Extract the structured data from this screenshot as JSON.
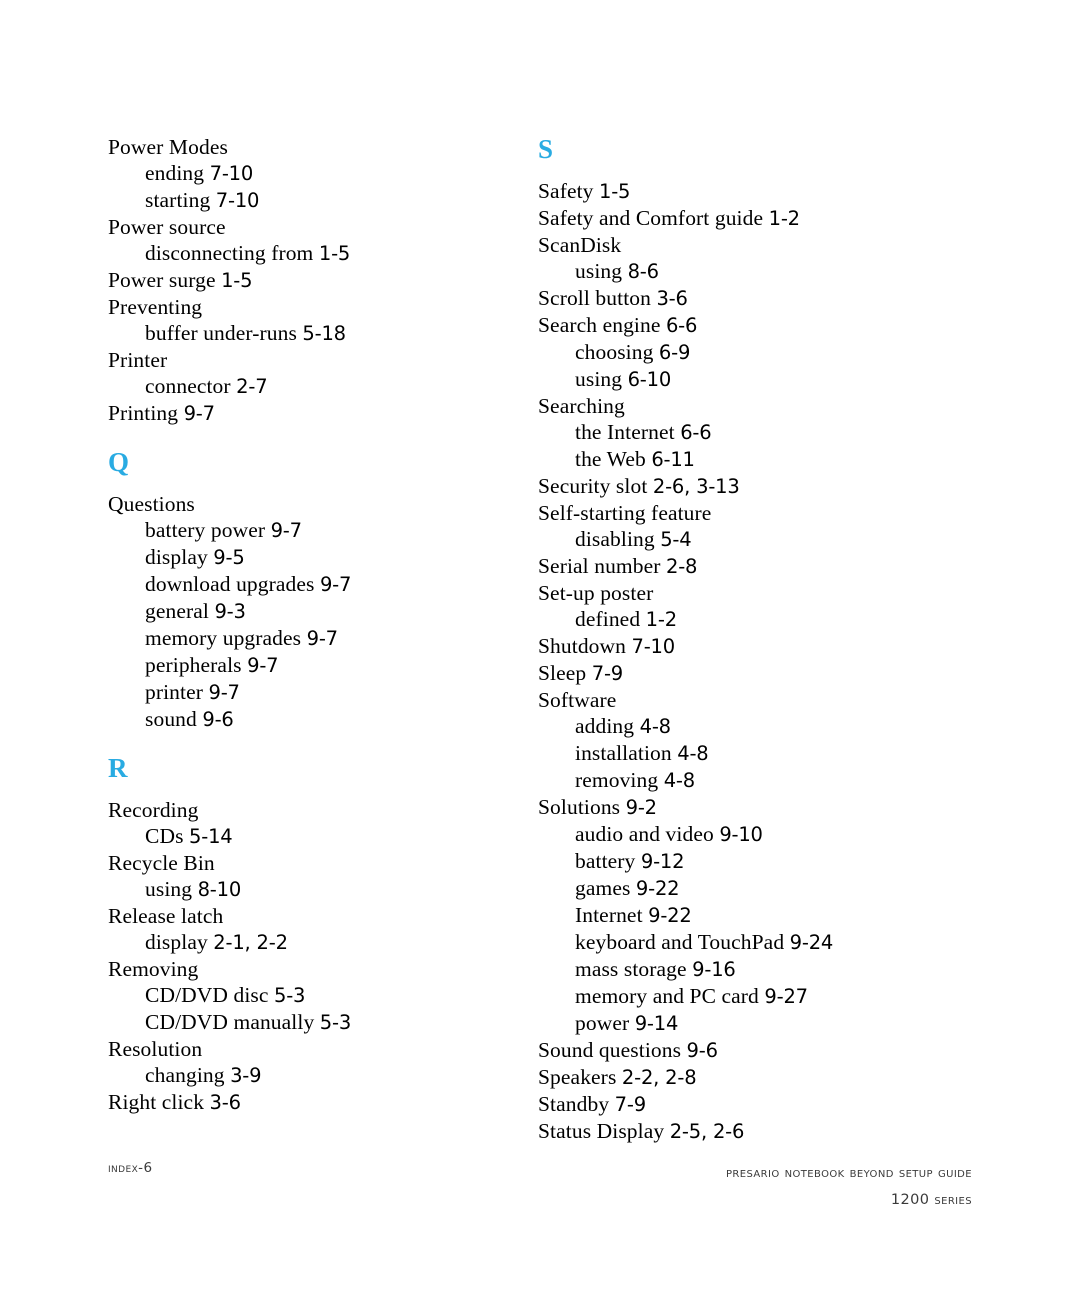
{
  "page": {
    "background_color": "#ffffff",
    "text_color": "#000000",
    "accent_color": "#29ABE2"
  },
  "footer": {
    "left": "Index-6",
    "right_line1": "Presario Notebook Beyond Setup Guide",
    "right_line2": "1200 Series"
  },
  "columns": [
    {
      "name": "left-column",
      "blocks": [
        {
          "type": "entries",
          "entries": [
            {
              "text": "Power Modes",
              "page": "",
              "level": 0
            },
            {
              "text": "ending",
              "page": "7-10",
              "level": 1
            },
            {
              "text": "starting",
              "page": "7-10",
              "level": 1
            },
            {
              "text": "Power source",
              "page": "",
              "level": 0
            },
            {
              "text": "disconnecting from",
              "page": "1-5",
              "level": 1
            },
            {
              "text": "Power surge",
              "page": "1-5",
              "level": 0
            },
            {
              "text": "Preventing",
              "page": "",
              "level": 0
            },
            {
              "text": "buffer under-runs",
              "page": "5-18",
              "level": 1
            },
            {
              "text": "Printer",
              "page": "",
              "level": 0
            },
            {
              "text": "connector",
              "page": "2-7",
              "level": 1
            },
            {
              "text": "Printing",
              "page": "9-7",
              "level": 0
            }
          ]
        },
        {
          "type": "section",
          "letter": "Q",
          "entries": [
            {
              "text": "Questions",
              "page": "",
              "level": 0
            },
            {
              "text": "battery power",
              "page": "9-7",
              "level": 1
            },
            {
              "text": "display",
              "page": "9-5",
              "level": 1
            },
            {
              "text": "download upgrades",
              "page": "9-7",
              "level": 1
            },
            {
              "text": "general",
              "page": "9-3",
              "level": 1
            },
            {
              "text": "memory upgrades",
              "page": "9-7",
              "level": 1
            },
            {
              "text": "peripherals",
              "page": "9-7",
              "level": 1
            },
            {
              "text": "printer",
              "page": "9-7",
              "level": 1
            },
            {
              "text": "sound",
              "page": "9-6",
              "level": 1
            }
          ]
        },
        {
          "type": "section",
          "letter": "R",
          "entries": [
            {
              "text": "Recording",
              "page": "",
              "level": 0
            },
            {
              "text": "CDs",
              "page": "5-14",
              "level": 1
            },
            {
              "text": "Recycle Bin",
              "page": "",
              "level": 0
            },
            {
              "text": "using",
              "page": "8-10",
              "level": 1
            },
            {
              "text": "Release latch",
              "page": "",
              "level": 0
            },
            {
              "text": "display",
              "page": "2-1, 2-2",
              "level": 1
            },
            {
              "text": "Removing",
              "page": "",
              "level": 0
            },
            {
              "text": "CD/DVD disc",
              "page": "5-3",
              "level": 1
            },
            {
              "text": "CD/DVD manually",
              "page": "5-3",
              "level": 1
            },
            {
              "text": "Resolution",
              "page": "",
              "level": 0
            },
            {
              "text": "changing",
              "page": "3-9",
              "level": 1
            },
            {
              "text": "Right click",
              "page": "3-6",
              "level": 0
            }
          ]
        }
      ]
    },
    {
      "name": "right-column",
      "blocks": [
        {
          "type": "section",
          "letter": "S",
          "entries": [
            {
              "text": "Safety",
              "page": "1-5",
              "level": 0
            },
            {
              "text": "Safety and Comfort guide",
              "page": "1-2",
              "level": 0
            },
            {
              "text": "ScanDisk",
              "page": "",
              "level": 0
            },
            {
              "text": "using",
              "page": "8-6",
              "level": 1
            },
            {
              "text": "Scroll button",
              "page": "3-6",
              "level": 0
            },
            {
              "text": "Search engine",
              "page": "6-6",
              "level": 0
            },
            {
              "text": "choosing",
              "page": "6-9",
              "level": 1
            },
            {
              "text": "using",
              "page": "6-10",
              "level": 1
            },
            {
              "text": "Searching",
              "page": "",
              "level": 0
            },
            {
              "text": "the Internet",
              "page": "6-6",
              "level": 1
            },
            {
              "text": "the Web",
              "page": "6-11",
              "level": 1
            },
            {
              "text": "Security slot",
              "page": "2-6, 3-13",
              "level": 0
            },
            {
              "text": "Self-starting feature",
              "page": "",
              "level": 0
            },
            {
              "text": "disabling",
              "page": "5-4",
              "level": 1
            },
            {
              "text": "Serial number",
              "page": "2-8",
              "level": 0
            },
            {
              "text": "Set-up poster",
              "page": "",
              "level": 0
            },
            {
              "text": "defined",
              "page": "1-2",
              "level": 1
            },
            {
              "text": "Shutdown",
              "page": "7-10",
              "level": 0
            },
            {
              "text": "Sleep",
              "page": "7-9",
              "level": 0
            },
            {
              "text": "Software",
              "page": "",
              "level": 0
            },
            {
              "text": "adding",
              "page": "4-8",
              "level": 1
            },
            {
              "text": "installation",
              "page": "4-8",
              "level": 1
            },
            {
              "text": "removing",
              "page": "4-8",
              "level": 1
            },
            {
              "text": "Solutions",
              "page": "9-2",
              "level": 0
            },
            {
              "text": "audio and video",
              "page": "9-10",
              "level": 1
            },
            {
              "text": "battery",
              "page": "9-12",
              "level": 1
            },
            {
              "text": "games",
              "page": "9-22",
              "level": 1
            },
            {
              "text": "Internet",
              "page": "9-22",
              "level": 1
            },
            {
              "text": "keyboard and TouchPad",
              "page": "9-24",
              "level": 1
            },
            {
              "text": "mass storage",
              "page": "9-16",
              "level": 1
            },
            {
              "text": "memory and PC card",
              "page": "9-27",
              "level": 1
            },
            {
              "text": "power",
              "page": "9-14",
              "level": 1
            },
            {
              "text": "Sound questions",
              "page": "9-6",
              "level": 0
            },
            {
              "text": "Speakers",
              "page": "2-2, 2-8",
              "level": 0
            },
            {
              "text": "Standby",
              "page": "7-9",
              "level": 0
            },
            {
              "text": "Status Display",
              "page": "2-5, 2-6",
              "level": 0
            }
          ]
        }
      ]
    }
  ]
}
